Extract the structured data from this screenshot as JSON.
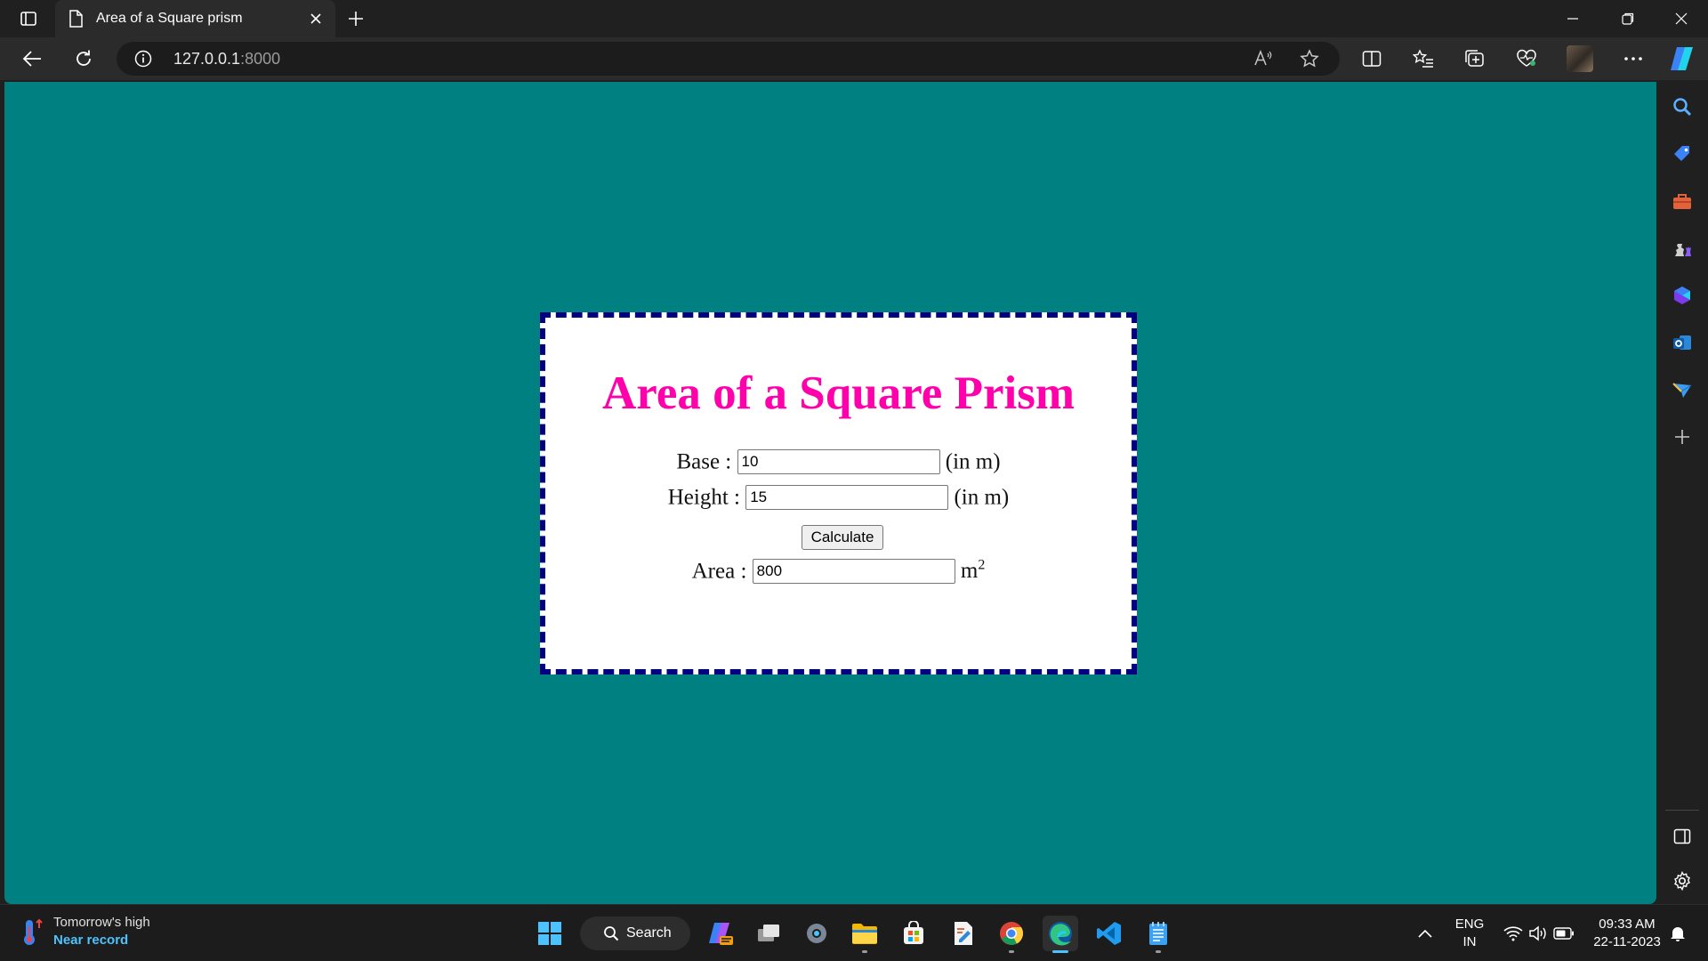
{
  "browser": {
    "tab_title": "Area of a Square prism",
    "url_host": "127.0.0.1",
    "url_port": ":8000"
  },
  "page": {
    "heading": "Area of a Square Prism",
    "base_label": "Base :",
    "base_value": "10",
    "base_unit": "(in m)",
    "height_label": "Height :",
    "height_value": "15",
    "height_unit": "(in m)",
    "calculate_label": "Calculate",
    "area_label": "Area :",
    "area_value": "800",
    "area_unit": "m",
    "area_unit_exp": "2"
  },
  "colors": {
    "page_bg": "#008080",
    "heading": "#ff00aa",
    "card_border": "#000080"
  },
  "taskbar": {
    "weather_line1": "Tomorrow's high",
    "weather_line2": "Near record",
    "search_label": "Search",
    "lang_line1": "ENG",
    "lang_line2": "IN",
    "time": "09:33 AM",
    "date": "22-11-2023"
  }
}
